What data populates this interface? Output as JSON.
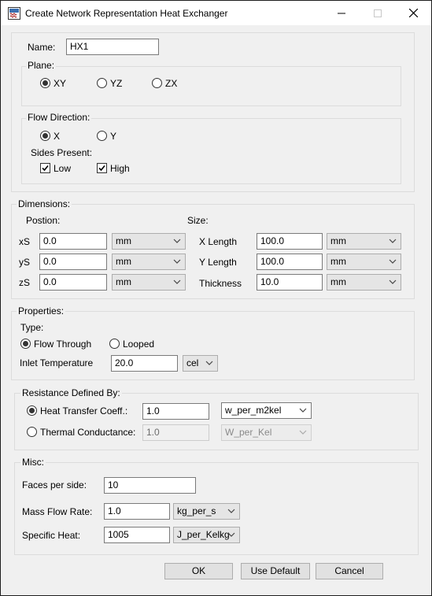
{
  "window": {
    "title": "Create Network Representation Heat Exchanger",
    "icons": {
      "app": "heat-exchanger-app-icon",
      "minimize": "minimize-icon",
      "maximize": "maximize-icon",
      "close": "close-icon"
    }
  },
  "name": {
    "label": "Name:",
    "value": "HX1"
  },
  "plane": {
    "title": "Plane:",
    "options": [
      "XY",
      "YZ",
      "ZX"
    ],
    "selected": "XY"
  },
  "flow_direction": {
    "title": "Flow Direction:",
    "options": [
      "X",
      "Y"
    ],
    "selected": "X",
    "sides_present_label": "Sides Present:",
    "sides": [
      {
        "label": "Low",
        "checked": true
      },
      {
        "label": "High",
        "checked": true
      }
    ]
  },
  "dimensions": {
    "title": "Dimensions:",
    "position_label": "Postion:",
    "size_label": "Size:",
    "position_rows": [
      {
        "label": "xS",
        "value": "0.0",
        "unit": "mm"
      },
      {
        "label": "yS",
        "value": "0.0",
        "unit": "mm"
      },
      {
        "label": "zS",
        "value": "0.0",
        "unit": "mm"
      }
    ],
    "size_rows": [
      {
        "label": "X Length",
        "value": "100.0",
        "unit": "mm"
      },
      {
        "label": "Y Length",
        "value": "100.0",
        "unit": "mm"
      },
      {
        "label": "Thickness",
        "value": "10.0",
        "unit": "mm"
      }
    ]
  },
  "properties": {
    "title": "Properties:",
    "type_label": "Type:",
    "type_options": [
      "Flow Through",
      "Looped"
    ],
    "type_selected": "Flow Through",
    "inlet_temp_label": "Inlet Temperature",
    "inlet_temp_value": "20.0",
    "inlet_temp_unit": "cel"
  },
  "resistance": {
    "title": "Resistance Defined By:",
    "rows": [
      {
        "label": "Heat Transfer Coeff.:",
        "value": "1.0",
        "unit": "w_per_m2kel",
        "selected": true,
        "enabled": true
      },
      {
        "label": "Thermal Conductance:",
        "value": "1.0",
        "unit": "W_per_Kel",
        "selected": false,
        "enabled": false
      }
    ]
  },
  "misc": {
    "title": "Misc:",
    "faces_label": "Faces per side:",
    "faces_value": "10",
    "mass_flow_label": "Mass Flow Rate:",
    "mass_flow_value": "1.0",
    "mass_flow_unit": "kg_per_s",
    "specific_heat_label": "Specific Heat:",
    "specific_heat_value": "1005",
    "specific_heat_unit": "J_per_Kelkg"
  },
  "buttons": {
    "ok": "OK",
    "use_default": "Use Default",
    "cancel": "Cancel"
  }
}
